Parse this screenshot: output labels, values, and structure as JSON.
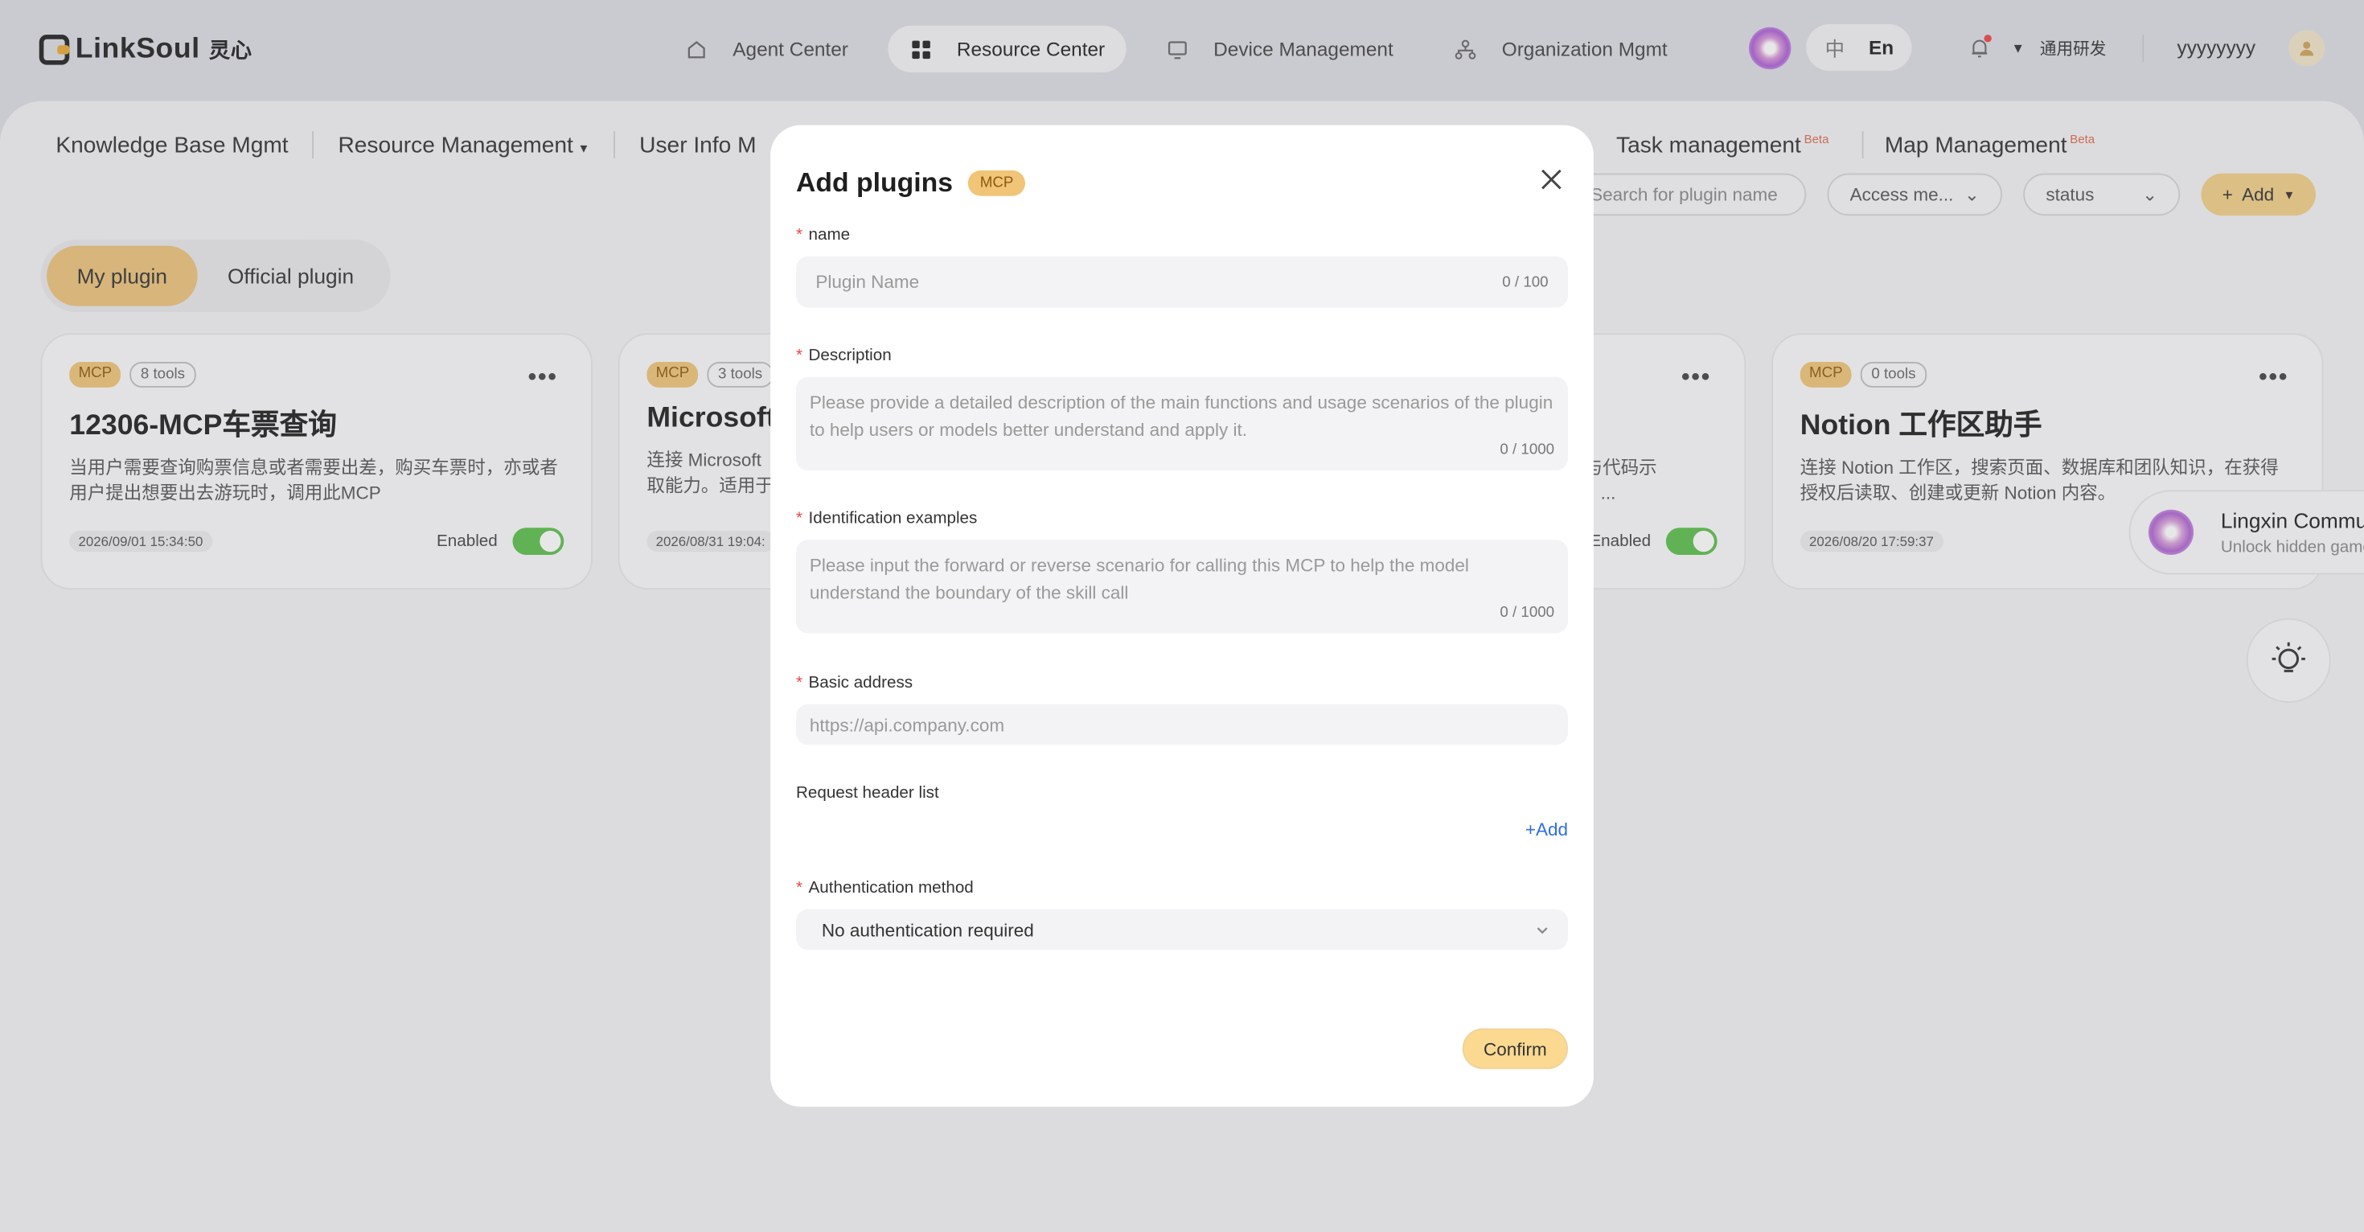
{
  "app": {
    "brand": "LinkSoul",
    "brand_cn": "灵心"
  },
  "nav": [
    {
      "label": "Agent Center",
      "icon": "home-icon"
    },
    {
      "label": "Resource Center",
      "icon": "grid-icon"
    },
    {
      "label": "Device Management",
      "icon": "monitor-icon"
    },
    {
      "label": "Organization Mgmt",
      "icon": "org-icon"
    }
  ],
  "topright": {
    "lang_cn": "中",
    "lang_en": "En",
    "org": "通用研发",
    "user": "yyyyyyyy"
  },
  "tabs": {
    "knowledge": "Knowledge Base Mgmt",
    "resource": "Resource Management",
    "userinfo": "User Info M",
    "task": "Task management",
    "map": "Map Management",
    "beta": "Beta"
  },
  "filters": {
    "search_placeholder": "Search for plugin name",
    "access": "Access me...",
    "status": "status",
    "add": "Add"
  },
  "segment": {
    "my": "My plugin",
    "official": "Official plugin"
  },
  "cards": [
    {
      "badge": "MCP",
      "tools": "8 tools",
      "title": "12306-MCP车票查询",
      "desc": "当用户需要查询购票信息或者需要出差，购买车票时，亦或者用户提出想要出去游玩时，调用此MCP",
      "date": "2026/09/01 15:34:50",
      "status": "Enabled"
    },
    {
      "badge": "MCP",
      "tools": "3 tools",
      "title": "Microsoft",
      "desc_line1": "连接 Microsoft",
      "desc_line2": "取能力。适用于",
      "date": "2026/08/31 19:04:"
    },
    {
      "desc_line1": "文档与代码示",
      "desc_line2": "eact、...",
      "status": "Enabled"
    },
    {
      "badge": "MCP",
      "tools": "0 tools",
      "title": "Notion 工作区助手",
      "desc": "连接 Notion 工作区，搜索页面、数据库和团队知识，在获得授权后读取、创建或更新 Notion 内容。",
      "date": "2026/08/20 17:59:37"
    }
  ],
  "community": {
    "title": "Lingxin Commun",
    "subtitle": "Unlock hidden gamep"
  },
  "modal": {
    "title": "Add plugins",
    "badge": "MCP",
    "name_label": "name",
    "name_placeholder": "Plugin Name",
    "name_count": "0 / 100",
    "desc_label": "Description",
    "desc_placeholder": "Please provide a detailed description of the main functions and usage scenarios of the plugin to help users or models better understand and apply it.",
    "desc_count": "0 / 1000",
    "ident_label": "Identification examples",
    "ident_placeholder": "Please input the forward or reverse scenario for calling this MCP to help the model understand the boundary of the skill call",
    "ident_count": "0 / 1000",
    "addr_label": "Basic address",
    "addr_placeholder": "https://api.company.com",
    "header_label": "Request header list",
    "header_add": "+Add",
    "auth_label": "Authentication method",
    "auth_value": "No authentication required",
    "confirm": "Confirm"
  }
}
